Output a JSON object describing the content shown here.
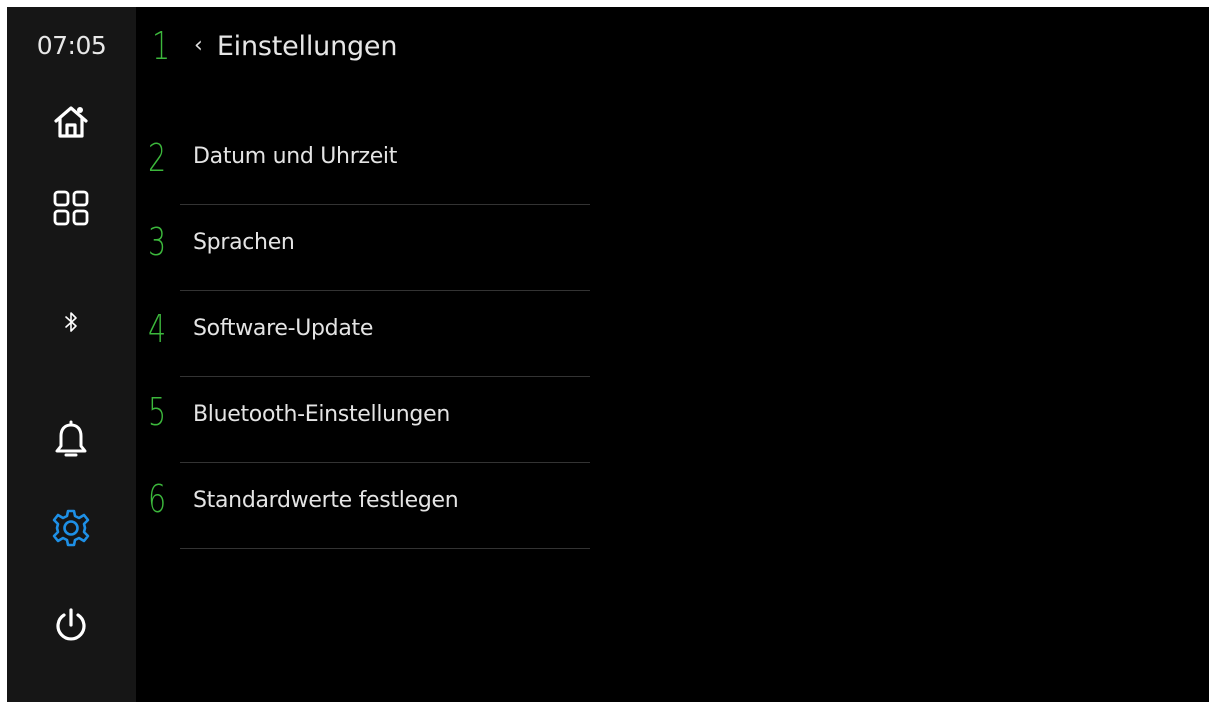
{
  "status": {
    "time": "07:05"
  },
  "sidebar": {
    "items": [
      {
        "icon": "home-icon",
        "active": false
      },
      {
        "icon": "apps-grid-icon",
        "active": false
      },
      {
        "icon": "bluetooth-icon",
        "active": false
      },
      {
        "icon": "bell-icon",
        "active": false
      },
      {
        "icon": "gear-icon",
        "active": true
      },
      {
        "icon": "power-icon",
        "active": false
      }
    ],
    "active_color": "#1e90e6",
    "icon_color": "#ffffff"
  },
  "header": {
    "back_icon": "chevron-left-icon",
    "title": "Einstellungen"
  },
  "markers": {
    "color": "#3cb83c",
    "values": [
      "1",
      "2",
      "3",
      "4",
      "5",
      "6"
    ]
  },
  "settings": {
    "items": [
      {
        "label": "Datum und Uhrzeit"
      },
      {
        "label": "Sprachen"
      },
      {
        "label": "Software-Update"
      },
      {
        "label": "Bluetooth-Einstellungen"
      },
      {
        "label": "Standardwerte festlegen"
      }
    ]
  }
}
